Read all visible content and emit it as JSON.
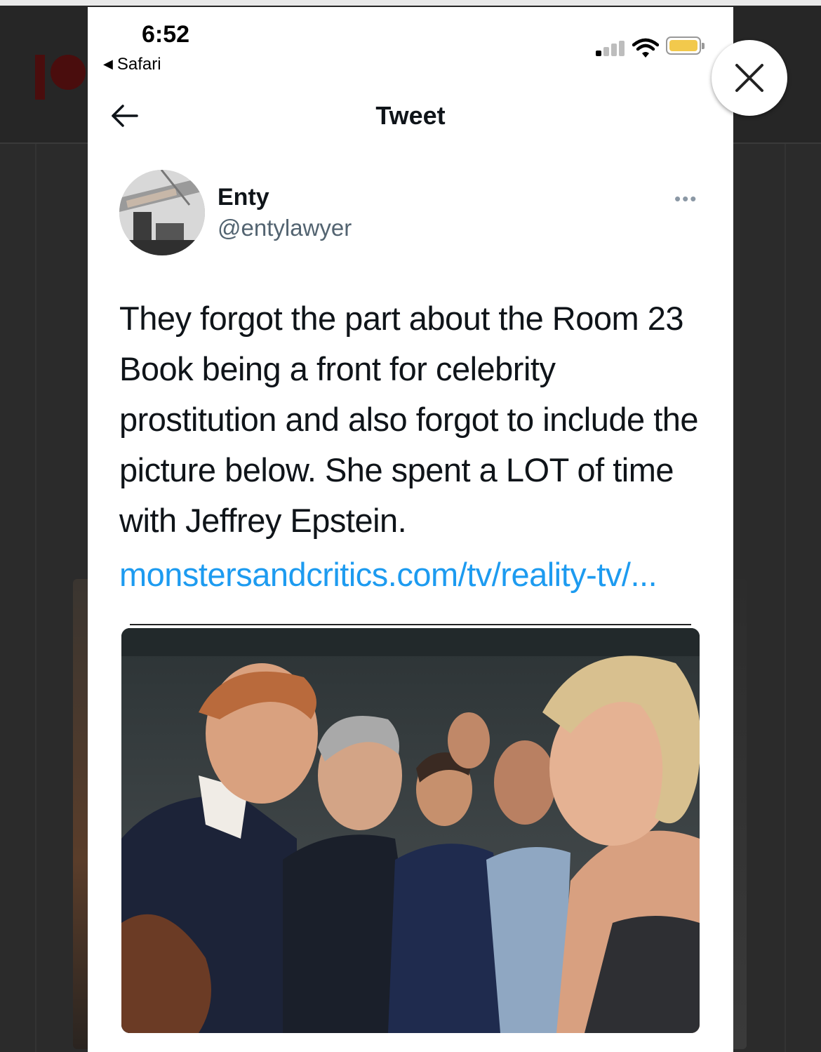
{
  "status_bar": {
    "time": "6:52",
    "back_app": "Safari",
    "battery_color": "#f2c94c"
  },
  "nav": {
    "title": "Tweet",
    "back_icon": "arrow-left-icon"
  },
  "tweet": {
    "author_name": "Enty",
    "author_handle": "@entylawyer",
    "more_label": "•••",
    "text": "They forgot the part about the Room 23 Book being a front for celebrity prostitution and also forgot to include the picture below. She spent a LOT of time with Jeffrey Epstein.",
    "link": "monstersandcritics.com/tv/reality-tv/..."
  },
  "overlay": {
    "close_icon": "close-icon"
  },
  "colors": {
    "link": "#1d9bf0",
    "text": "#0f1419",
    "handle": "#536471",
    "background_dim": "#2b2b2b"
  }
}
